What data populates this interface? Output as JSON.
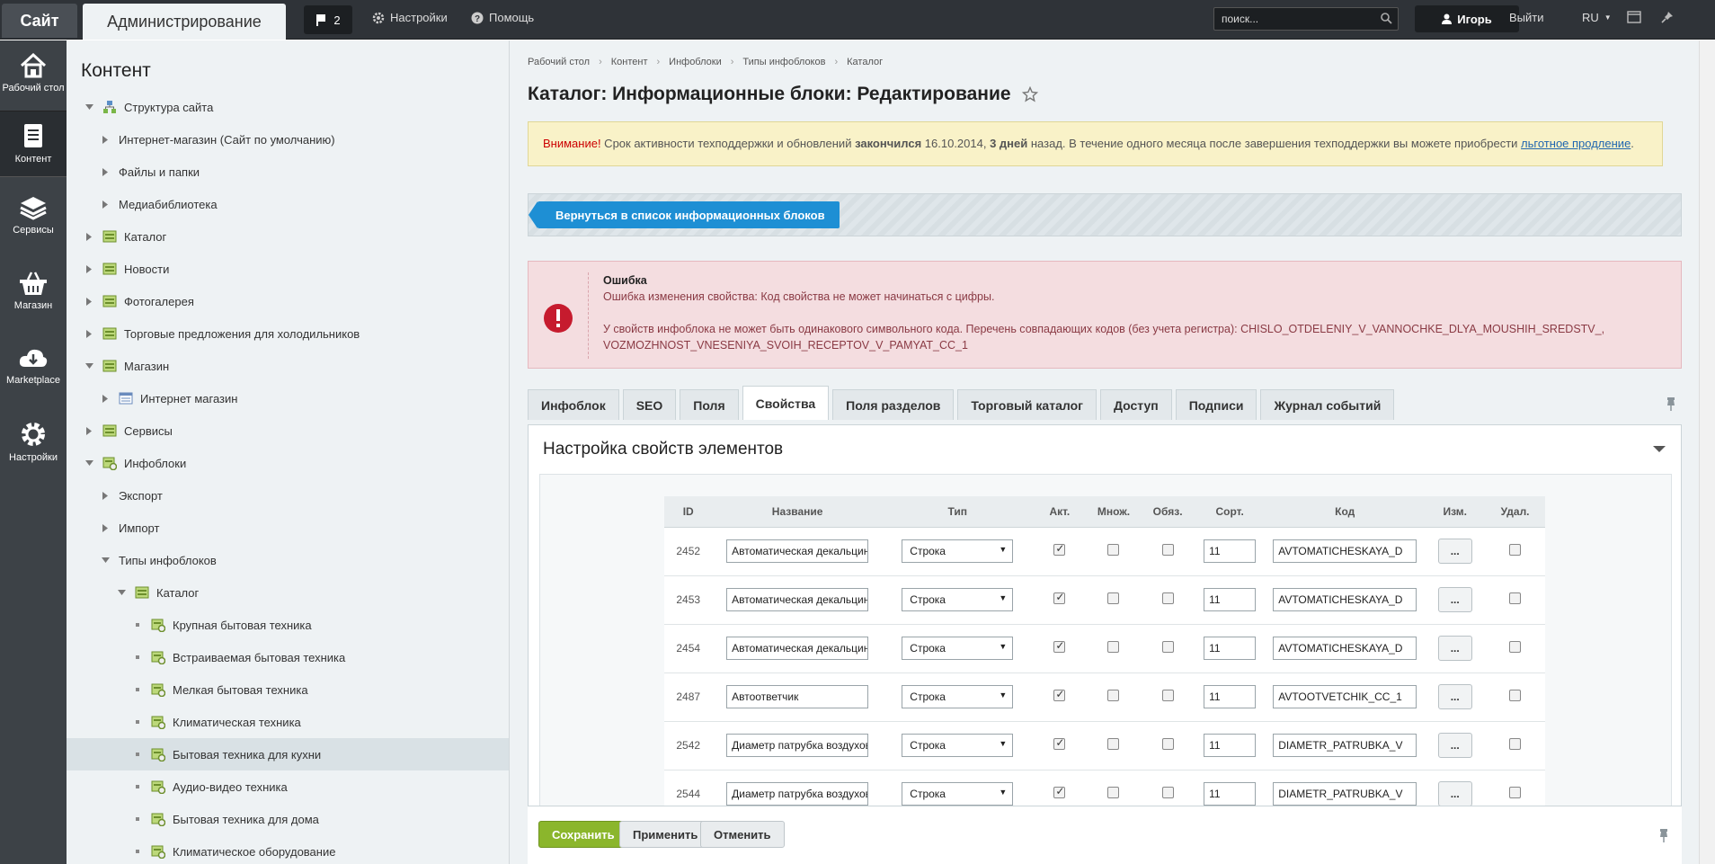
{
  "topbar": {
    "site": "Сайт",
    "admin": "Администрирование",
    "notif_count": "2",
    "settings": "Настройки",
    "help": "Помощь",
    "search_placeholder": "поиск...",
    "user": "Игорь",
    "logout": "Выйти",
    "lang": "RU"
  },
  "rail": [
    {
      "label": "Рабочий стол",
      "icon": "home-icon"
    },
    {
      "label": "Контент",
      "icon": "document-icon"
    },
    {
      "label": "Сервисы",
      "icon": "layers-icon"
    },
    {
      "label": "Магазин",
      "icon": "basket-icon"
    },
    {
      "label": "Marketplace",
      "icon": "cloud-download-icon"
    },
    {
      "label": "Настройки",
      "icon": "gear-icon"
    }
  ],
  "tree": {
    "title": "Контент",
    "items": [
      {
        "label": "Структура сайта"
      },
      {
        "label": "Интернет-магазин (Сайт по умолчанию)"
      },
      {
        "label": "Файлы и папки"
      },
      {
        "label": "Медиабиблиотека"
      },
      {
        "label": "Каталог"
      },
      {
        "label": "Новости"
      },
      {
        "label": "Фотогалерея"
      },
      {
        "label": "Торговые предложения для холодильников"
      },
      {
        "label": "Магазин"
      },
      {
        "label": "Интернет магазин"
      },
      {
        "label": "Сервисы"
      },
      {
        "label": "Инфоблоки"
      },
      {
        "label": "Экспорт"
      },
      {
        "label": "Импорт"
      },
      {
        "label": "Типы инфоблоков"
      },
      {
        "label": "Каталог"
      },
      {
        "label": "Крупная бытовая техника"
      },
      {
        "label": "Встраиваемая бытовая техника"
      },
      {
        "label": "Мелкая бытовая техника"
      },
      {
        "label": "Климатическая техника"
      },
      {
        "label": "Бытовая техника для кухни"
      },
      {
        "label": "Аудио-видео техника"
      },
      {
        "label": "Бытовая техника для дома"
      },
      {
        "label": "Климатическое оборудование"
      }
    ]
  },
  "breadcrumbs": [
    "Рабочий стол",
    "Контент",
    "Инфоблоки",
    "Типы инфоблоков",
    "Каталог"
  ],
  "page_title": "Каталог: Информационные блоки: Редактирование",
  "warning": {
    "attention": "Внимание!",
    "t1": " Срок активности техподдержки и обновлений ",
    "ended": "закончился",
    "t2": " 16.10.2014, ",
    "days": "3 дней",
    "t3": " назад. В течение одного месяца после завершения техподдержки вы можете приобрести ",
    "link": "льготное продление",
    "t4": "."
  },
  "back_button": "Вернуться в список информационных блоков",
  "error": {
    "title": "Ошибка",
    "line1": "Ошибка изменения свойства: Код свойства не может начинаться с цифры.",
    "line2": "У свойств инфоблока не может быть одинакового символьного кода. Перечень совпадающих кодов (без учета регистра): CHISLO_OTDELENIY_V_VANNOCHKE_DLYA_MOUSHIH_SREDSTV_,",
    "line3": "VOZMOZHNOST_VNESENIYA_SVOIH_RECEPTOV_V_PAMYAT_CC_1"
  },
  "tabs": [
    "Инфоблок",
    "SEO",
    "Поля",
    "Свойства",
    "Поля разделов",
    "Торговый каталог",
    "Доступ",
    "Подписи",
    "Журнал событий"
  ],
  "panel_title": "Настройка свойств элементов",
  "table": {
    "headers": [
      "ID",
      "Название",
      "Тип",
      "Акт.",
      "Множ.",
      "Обяз.",
      "Сорт.",
      "Код",
      "Изм.",
      "Удал."
    ],
    "rows": [
      {
        "id": "2452",
        "name": "Автоматическая декальцинац",
        "type": "Строка",
        "sort": "11",
        "code": "AVTOMATICHESKAYA_D",
        "edit": "..."
      },
      {
        "id": "2453",
        "name": "Автоматическая декальцинац",
        "type": "Строка",
        "sort": "11",
        "code": "AVTOMATICHESKAYA_D",
        "edit": "..."
      },
      {
        "id": "2454",
        "name": "Автоматическая декальцинац",
        "type": "Строка",
        "sort": "11",
        "code": "AVTOMATICHESKAYA_D",
        "edit": "..."
      },
      {
        "id": "2487",
        "name": "Автоответчик",
        "type": "Строка",
        "sort": "11",
        "code": "AVTOOTVETCHIK_CC_1",
        "edit": "..."
      },
      {
        "id": "2542",
        "name": "Диаметр патрубка воздуховод",
        "type": "Строка",
        "sort": "11",
        "code": "DIAMETR_PATRUBKA_V",
        "edit": "..."
      },
      {
        "id": "2544",
        "name": "Диаметр патрубка воздуховод",
        "type": "Строка",
        "sort": "11",
        "code": "DIAMETR_PATRUBKA_V",
        "edit": "..."
      }
    ]
  },
  "footer": {
    "save": "Сохранить",
    "apply": "Применить",
    "cancel": "Отменить"
  }
}
